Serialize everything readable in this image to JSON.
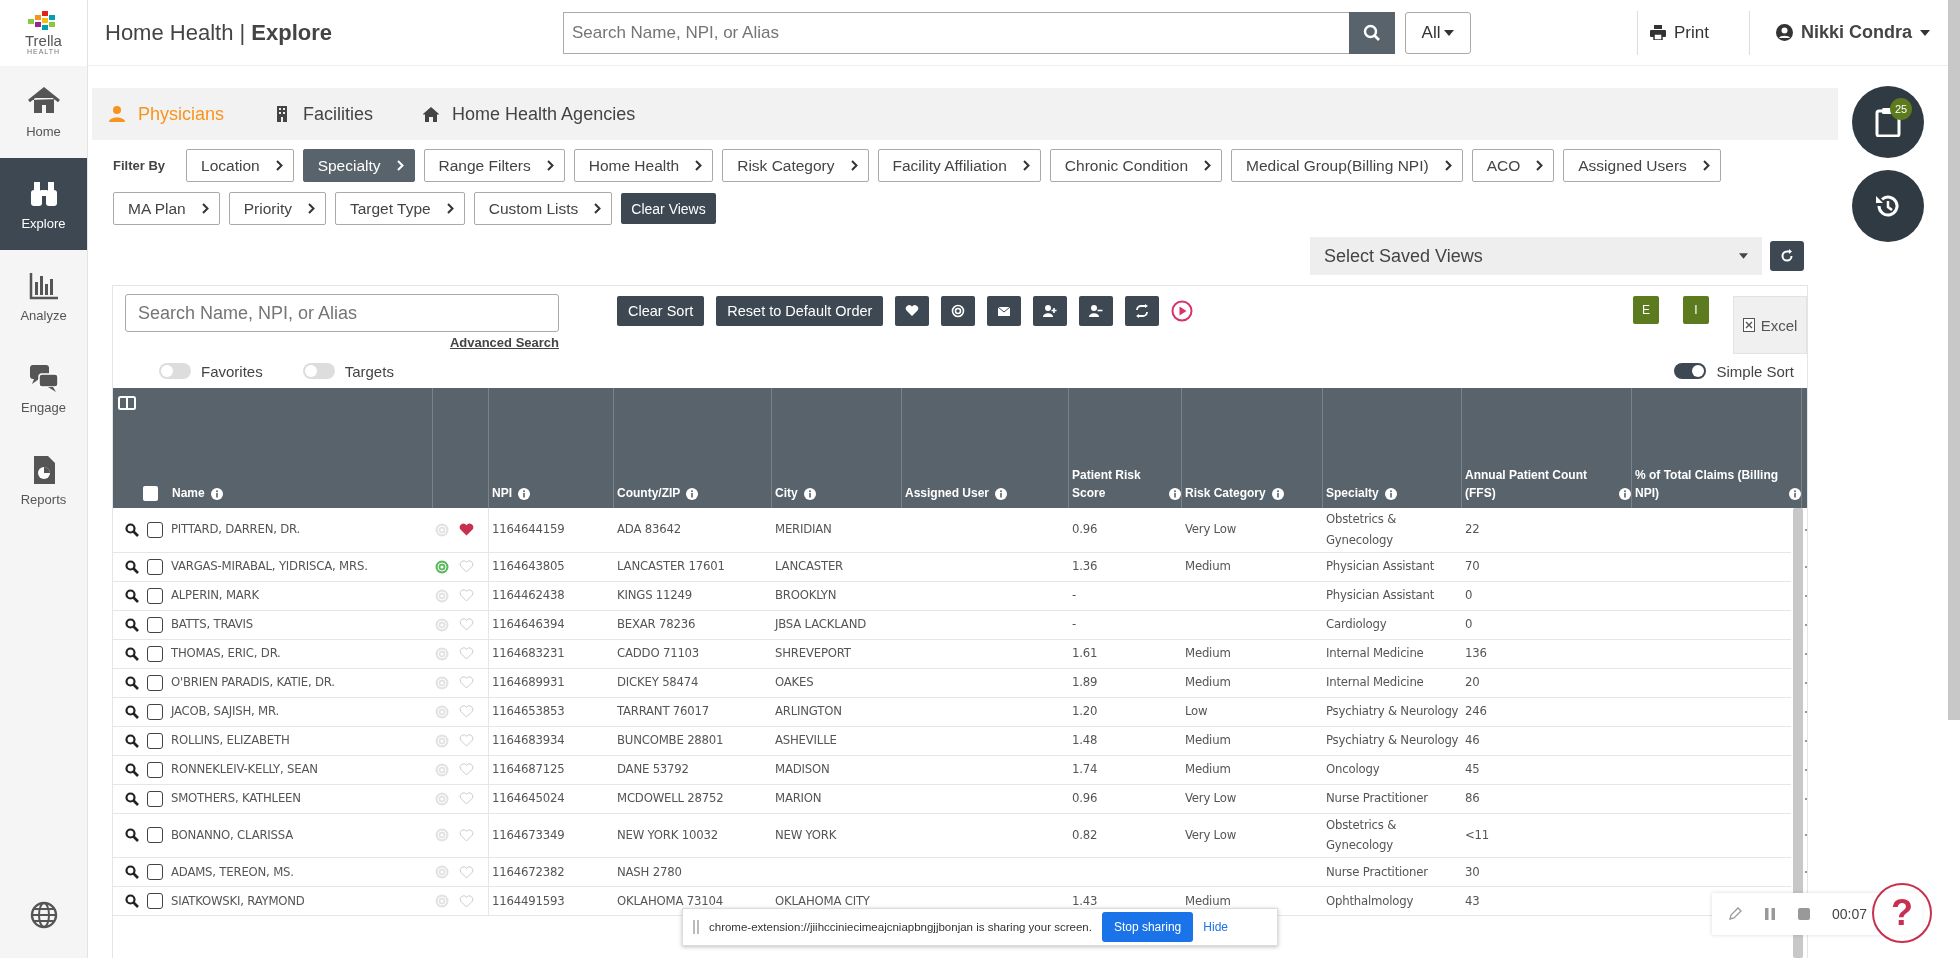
{
  "logo": {
    "name": "Trella",
    "sub": "HEALTH"
  },
  "header": {
    "app": "Home Health",
    "separator": "|",
    "page": "Explore",
    "search": {
      "placeholder": "Search Name, NPI, or Alias"
    },
    "scope": "All",
    "print": "Print",
    "user": "Nikki Condra"
  },
  "sidebar": {
    "items": [
      {
        "kind": "home",
        "label": "Home",
        "selected": false
      },
      {
        "kind": "explore",
        "label": "Explore",
        "selected": true
      },
      {
        "kind": "analyze",
        "label": "Analyze",
        "selected": false
      },
      {
        "kind": "engage",
        "label": "Engage",
        "selected": false
      },
      {
        "kind": "reports",
        "label": "Reports",
        "selected": false
      }
    ]
  },
  "tabs": [
    {
      "kind": "person",
      "label": "Physicians",
      "selected": true
    },
    {
      "kind": "building",
      "label": "Facilities",
      "selected": false
    },
    {
      "kind": "house",
      "label": "Home Health Agencies",
      "selected": false
    }
  ],
  "filters": {
    "label": "Filter By",
    "items": [
      {
        "label": "Location",
        "selected": false
      },
      {
        "label": "Specialty",
        "selected": true
      },
      {
        "label": "Range Filters",
        "selected": false
      },
      {
        "label": "Home Health",
        "selected": false
      },
      {
        "label": "Risk Category",
        "selected": false
      },
      {
        "label": "Facility Affiliation",
        "selected": false
      },
      {
        "label": "Chronic Condition",
        "selected": false
      },
      {
        "label": "Medical Group(Billing NPI)",
        "selected": false
      },
      {
        "label": "ACO",
        "selected": false
      },
      {
        "label": "Assigned Users",
        "selected": false
      },
      {
        "label": "MA Plan",
        "selected": false
      },
      {
        "label": "Priority",
        "selected": false
      },
      {
        "label": "Target Type",
        "selected": false
      },
      {
        "label": "Custom Lists",
        "selected": false
      }
    ],
    "clear": "Clear Views"
  },
  "saved_views": {
    "placeholder": "Select Saved Views"
  },
  "toolbar": {
    "search": {
      "placeholder": "Search Name, NPI, or Alias"
    },
    "advanced": "Advanced Search",
    "buttons": [
      "Clear Sort",
      "Reset to Default Order"
    ],
    "e": "E",
    "i": "I",
    "excel": "Excel"
  },
  "toggles": [
    {
      "label": "Favorites",
      "on": false
    },
    {
      "label": "Targets",
      "on": false
    }
  ],
  "simple_sort": {
    "label": "Simple Sort",
    "on": true
  },
  "table": {
    "select_all": {
      "checked": false
    },
    "columns": [
      "Name",
      "NPI",
      "County/ZIP",
      "City",
      "Assigned User",
      "Patient Risk Score",
      "Risk Category",
      "Specialty",
      "Annual Patient Count (FFS)",
      "% of Total Claims (Billing NPI)"
    ],
    "rows": [
      {
        "name": "PITTARD, DARREN, DR.",
        "checked": false,
        "target": false,
        "favorite": true,
        "npi": "1164644159",
        "county": "ADA 83642",
        "city": "MERIDIAN",
        "score": "0.96",
        "risk": "Very Low",
        "specialty": "Obstetrics & Gynecology",
        "count": "22"
      },
      {
        "name": "VARGAS-MIRABAL, YIDRISCA, MRS.",
        "checked": false,
        "target": true,
        "favorite": false,
        "npi": "1164643805",
        "county": "LANCASTER 17601",
        "city": "LANCASTER",
        "score": "1.36",
        "risk": "Medium",
        "specialty": "Physician Assistant",
        "count": "70"
      },
      {
        "name": "ALPERIN, MARK",
        "checked": false,
        "target": false,
        "favorite": false,
        "npi": "1164462438",
        "county": "KINGS 11249",
        "city": "BROOKLYN",
        "score": "-",
        "specialty": "Physician Assistant",
        "count": "0"
      },
      {
        "name": "BATTS, TRAVIS",
        "checked": false,
        "target": false,
        "favorite": false,
        "npi": "1164646394",
        "county": "BEXAR 78236",
        "city": "JBSA LACKLAND",
        "score": "-",
        "specialty": "Cardiology",
        "count": "0"
      },
      {
        "name": "THOMAS, ERIC, DR.",
        "checked": false,
        "target": false,
        "favorite": false,
        "npi": "1164683231",
        "county": "CADDO 71103",
        "city": "SHREVEPORT",
        "score": "1.61",
        "risk": "Medium",
        "specialty": "Internal Medicine",
        "count": "136"
      },
      {
        "name": "O'BRIEN PARADIS, KATIE, DR.",
        "checked": false,
        "target": false,
        "favorite": false,
        "npi": "1164689931",
        "county": "DICKEY 58474",
        "city": "OAKES",
        "score": "1.89",
        "risk": "Medium",
        "specialty": "Internal Medicine",
        "count": "20"
      },
      {
        "name": "JACOB, SAJISH, MR.",
        "checked": false,
        "target": false,
        "favorite": false,
        "npi": "1164653853",
        "county": "TARRANT 76017",
        "city": "ARLINGTON",
        "score": "1.20",
        "risk": "Low",
        "specialty": "Psychiatry & Neurology",
        "count": "246"
      },
      {
        "name": "ROLLINS, ELIZABETH",
        "checked": false,
        "target": false,
        "favorite": false,
        "npi": "1164683934",
        "county": "BUNCOMBE 28801",
        "city": "ASHEVILLE",
        "score": "1.48",
        "risk": "Medium",
        "specialty": "Psychiatry & Neurology",
        "count": "46"
      },
      {
        "name": "RONNEKLEIV-KELLY, SEAN",
        "checked": false,
        "target": false,
        "favorite": false,
        "npi": "1164687125",
        "county": "DANE 53792",
        "city": "MADISON",
        "score": "1.74",
        "risk": "Medium",
        "specialty": "Oncology",
        "count": "45"
      },
      {
        "name": "SMOTHERS, KATHLEEN",
        "checked": false,
        "target": false,
        "favorite": false,
        "npi": "1164645024",
        "county": "MCDOWELL 28752",
        "city": "MARION",
        "score": "0.96",
        "risk": "Very Low",
        "specialty": "Nurse Practitioner",
        "count": "86"
      },
      {
        "name": "BONANNO, CLARISSA",
        "checked": false,
        "target": false,
        "favorite": false,
        "npi": "1164673349",
        "county": "NEW YORK 10032",
        "city": "NEW YORK",
        "score": "0.82",
        "risk": "Very Low",
        "specialty": "Obstetrics & Gynecology",
        "count": "<11"
      },
      {
        "name": "ADAMS, TEREON, MS.",
        "checked": false,
        "target": false,
        "favorite": false,
        "npi": "1164672382",
        "county": "NASH 2780",
        "specialty": "Nurse Practitioner",
        "count": "30"
      },
      {
        "name": "SIATKOWSKI, RAYMOND",
        "checked": false,
        "target": false,
        "favorite": false,
        "npi": "1164491593",
        "county": "OKLAHOMA 73104",
        "city": "OKLAHOMA CITY",
        "score": "1.43",
        "risk": "Medium",
        "specialty": "Ophthalmology",
        "count": "43"
      }
    ]
  },
  "side_buttons": {
    "badge": "25"
  },
  "share_bar": {
    "message": "chrome-extension://jiihcciniecimeajcniapbngjjbonjan is sharing your screen.",
    "stop": "Stop sharing",
    "hide": "Hide"
  },
  "recorder": {
    "time": "00:07",
    "help": "?"
  }
}
